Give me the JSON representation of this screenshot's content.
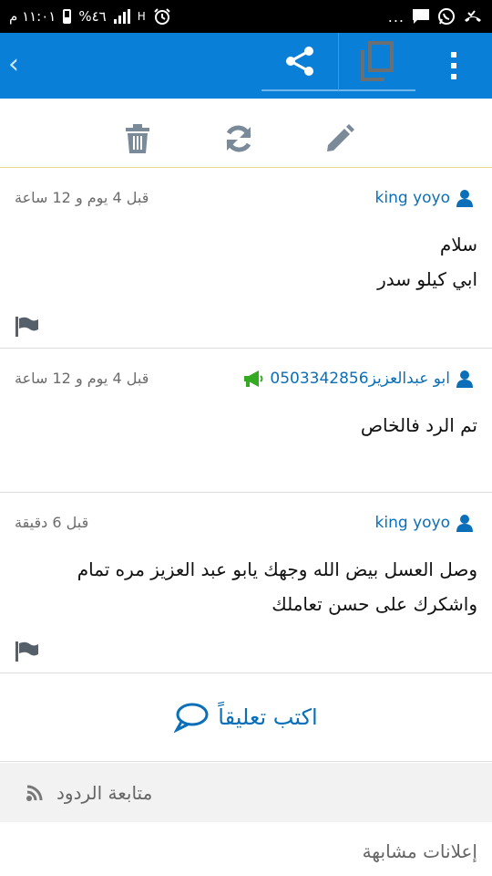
{
  "status_bar": {
    "time": "١١:٠١ م",
    "battery": "%٤٦",
    "network": "H",
    "dots": "..."
  },
  "colors": {
    "status_bar": "#000000",
    "app_bar": "#0a7fd8",
    "link": "#0a6fb8",
    "icon_gray": "#7a8a99",
    "megaphone": "#33aa22"
  },
  "app_bar": {
    "icons": [
      "back-chevron-icon",
      "share-icon",
      "copy-icon",
      "overflow-menu-icon"
    ],
    "back_glyph": "‹"
  },
  "actions": {
    "icons": [
      "delete-icon",
      "refresh-icon",
      "edit-icon"
    ]
  },
  "comments": [
    {
      "author": "king yoyo",
      "time": "قبل 4 يوم و 12 ساعة",
      "lines": [
        "سلام",
        "ابي كيلو سدر"
      ],
      "has_flag": true
    },
    {
      "author": "ابو عبدالعزيز0503342856",
      "time": "قبل 4 يوم و 12 ساعة",
      "lines": [
        "تم الرد فالخاص"
      ],
      "has_flag": false,
      "has_megaphone": true
    },
    {
      "author": "king yoyo",
      "time": "قبل 6 دقيقة",
      "lines": [
        "وصل العسل بيض الله وجهك يابو عبد العزيز مره تمام",
        "واشكرك على حسن تعاملك"
      ],
      "has_flag": true
    }
  ],
  "write_comment": {
    "label": "اكتب تعليقاً"
  },
  "follow": {
    "label": "متابعة الردود"
  },
  "similar": {
    "label": "إعلانات مشابهة"
  }
}
